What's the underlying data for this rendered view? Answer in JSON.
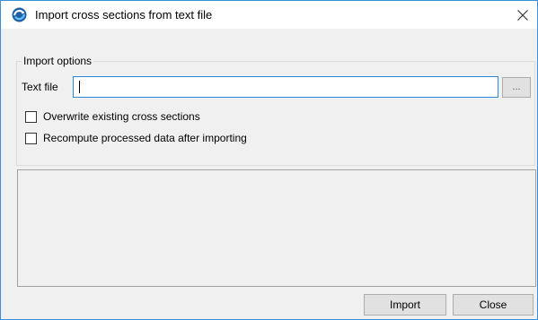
{
  "window": {
    "title": "Import cross sections from text file",
    "close_glyph": "✕",
    "app_icon": "refresh-cycle-icon",
    "accent_color": "#3c8fd6"
  },
  "import_options": {
    "group_label": "Import options",
    "textfile_label": "Text file",
    "textfile_value": "",
    "browse_label": "...",
    "overwrite_label": "Overwrite existing cross sections",
    "overwrite_checked": false,
    "recompute_label": "Recompute processed data after importing",
    "recompute_checked": false
  },
  "messages": {
    "text": ""
  },
  "buttons": {
    "import_label": "Import",
    "close_label": "Close"
  }
}
